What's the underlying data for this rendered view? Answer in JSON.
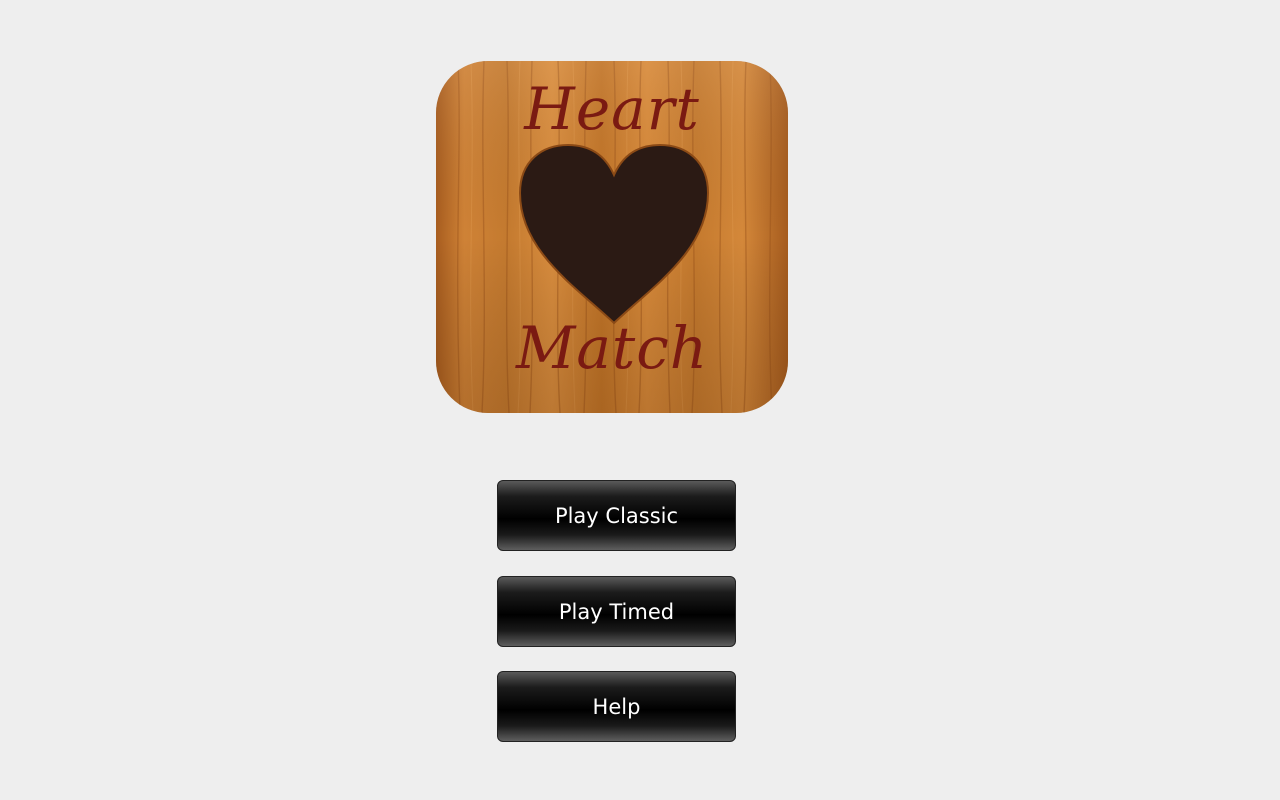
{
  "logo": {
    "word_top": "Heart",
    "word_bottom": "Match",
    "colors": {
      "wood": "#c8782b",
      "wood_dark": "#a85a1c",
      "heart": "#2b1a14",
      "lettering": "#7a1a12"
    }
  },
  "menu": {
    "play_classic": "Play Classic",
    "play_timed": "Play Timed",
    "help": "Help"
  },
  "colors": {
    "background": "#eeeeee",
    "button_text": "#ffffff",
    "button_fill": "#000000"
  }
}
